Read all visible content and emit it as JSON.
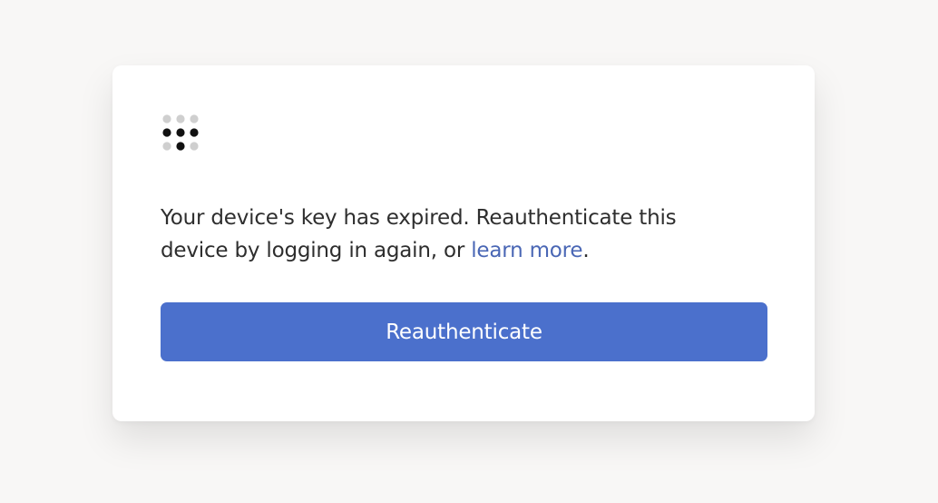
{
  "dialog": {
    "message_before": "Your device's key has expired. Reauthenticate this device by logging in again, or ",
    "link_text": "learn more",
    "message_after": ".",
    "button_label": "Reauthenticate"
  },
  "logo": {
    "icon": "tailscale-logo-icon"
  },
  "colors": {
    "accent": "#4b70cc",
    "link": "#4a67b5",
    "text": "#2e2e2e",
    "background": "#f8f7f6",
    "card": "#ffffff",
    "dot_dark": "#111111",
    "dot_light": "#cfcfcf"
  }
}
